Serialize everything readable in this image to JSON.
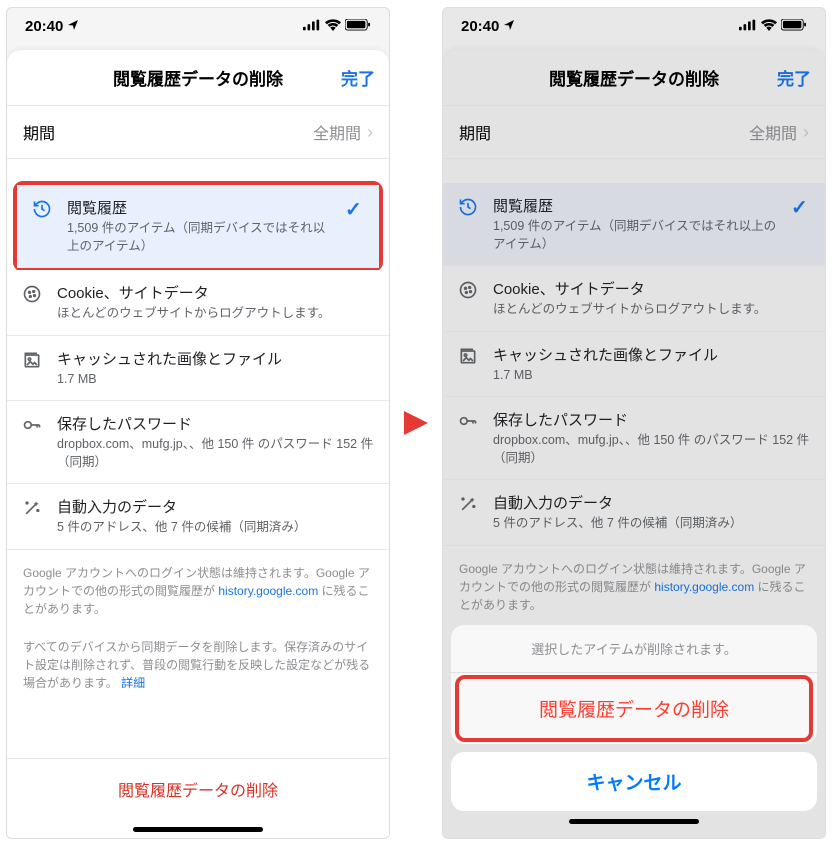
{
  "status": {
    "time": "20:40",
    "loc_glyph": "➤",
    "signal": "▮▮▮▮",
    "wifi": "🗢",
    "battery": "▮▮▮"
  },
  "header": {
    "title": "閲覧履歴データの削除",
    "done": "完了"
  },
  "period": {
    "label": "期間",
    "value": "全期間"
  },
  "items": [
    {
      "title": "閲覧履歴",
      "sub": "1,509 件のアイテム（同期デバイスではそれ以上のアイテム）",
      "icon": "history"
    },
    {
      "title": "Cookie、サイトデータ",
      "sub": "ほとんどのウェブサイトからログアウトします。",
      "icon": "cookie"
    },
    {
      "title": "キャッシュされた画像とファイル",
      "sub": "1.7 MB",
      "icon": "cache"
    },
    {
      "title": "保存したパスワード",
      "sub": "dropbox.com、mufg.jp、、他 150 件 のパスワード 152 件（同期）",
      "icon": "key"
    },
    {
      "title": "自動入力のデータ",
      "sub": "5 件のアドレス、他 7 件の候補（同期済み）",
      "icon": "autofill"
    }
  ],
  "footer1a": "Google アカウントへのログイン状態は維持されます。Google アカウントでの他の形式の閲覧履歴が",
  "footer1link": "history.google.com",
  "footer1b": " に残ることがあります。",
  "footer2a": "すべてのデバイスから同期データを削除します。保存済みのサイト設定は削除されず、普段の閲覧行動を反映した設定などが残る場合があります。",
  "footer2link": "詳細",
  "deleteBtn": "閲覧履歴データの削除",
  "actionSheet": {
    "title": "選択したアイテムが削除されます。",
    "action": "閲覧履歴データの削除",
    "cancel": "キャンセル"
  }
}
